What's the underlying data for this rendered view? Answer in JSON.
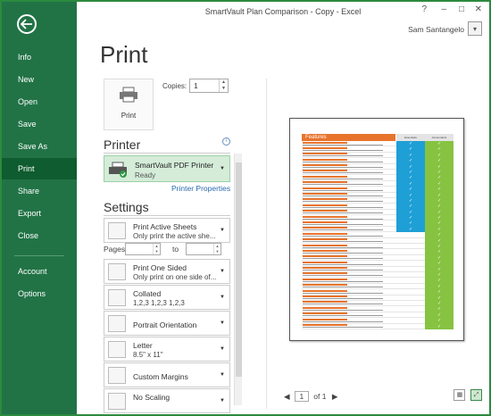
{
  "window": {
    "title": "SmartVault Plan Comparison - Copy - Excel",
    "help": "?",
    "minimize": "–",
    "restore": "□",
    "close": "✕",
    "user": "Sam Santangelo"
  },
  "nav": {
    "back_icon": "back-arrow-icon",
    "items": [
      {
        "label": "Info"
      },
      {
        "label": "New"
      },
      {
        "label": "Open"
      },
      {
        "label": "Save"
      },
      {
        "label": "Save As"
      },
      {
        "label": "Print",
        "active": true
      },
      {
        "label": "Share"
      },
      {
        "label": "Export"
      },
      {
        "label": "Close"
      },
      {
        "label": "Account"
      },
      {
        "label": "Options"
      }
    ]
  },
  "page": {
    "title": "Print",
    "print_button": "Print",
    "copies_label": "Copies:",
    "copies_value": "1"
  },
  "printer": {
    "heading": "Printer",
    "name": "SmartVault PDF Printer",
    "status": "Ready",
    "properties_link": "Printer Properties"
  },
  "settings": {
    "heading": "Settings",
    "pages_label": "Pages:",
    "to_label": "to",
    "options": [
      {
        "line1": "Print Active Sheets",
        "line2": "Only print the active she..."
      },
      {
        "line1": "Print One Sided",
        "line2": "Only print on one side of..."
      },
      {
        "line1": "Collated",
        "line2": "1,2,3    1,2,3    1,2,3"
      },
      {
        "line1": "Portrait Orientation",
        "line2": ""
      },
      {
        "line1": "Letter",
        "line2": "8.5\" x 11\""
      },
      {
        "line1": "Custom Margins",
        "line2": ""
      },
      {
        "line1": "No Scaling",
        "line2": ""
      }
    ]
  },
  "preview": {
    "features_title": "Features",
    "col1": "Essentials",
    "col2": "Accountants",
    "rows": [
      [
        true,
        true
      ],
      [
        true,
        true
      ],
      [
        true,
        true
      ],
      [
        true,
        true
      ],
      [
        true,
        true
      ],
      [
        true,
        true
      ],
      [
        true,
        true
      ],
      [
        true,
        true
      ],
      [
        true,
        true
      ],
      [
        true,
        true
      ],
      [
        true,
        true
      ],
      [
        true,
        true
      ],
      [
        true,
        true
      ],
      [
        true,
        true
      ],
      [
        true,
        true
      ],
      [
        true,
        true
      ],
      [
        false,
        true
      ],
      [
        false,
        true
      ],
      [
        false,
        true
      ],
      [
        false,
        true
      ],
      [
        false,
        true
      ],
      [
        false,
        true
      ],
      [
        false,
        true
      ],
      [
        false,
        true
      ],
      [
        false,
        true
      ],
      [
        false,
        true
      ],
      [
        false,
        true
      ],
      [
        false,
        true
      ],
      [
        false,
        true
      ],
      [
        false,
        true
      ],
      [
        false,
        true
      ],
      [
        false,
        true
      ],
      [
        false,
        true
      ]
    ],
    "check": "✓",
    "page_current": "1",
    "page_of": "of 1",
    "prev": "◀",
    "next": "▶"
  },
  "colors": {
    "nav_bg": "#217346",
    "accent_orange": "#e8742c",
    "accent_blue": "#1e9fd6",
    "accent_green": "#86c341"
  }
}
